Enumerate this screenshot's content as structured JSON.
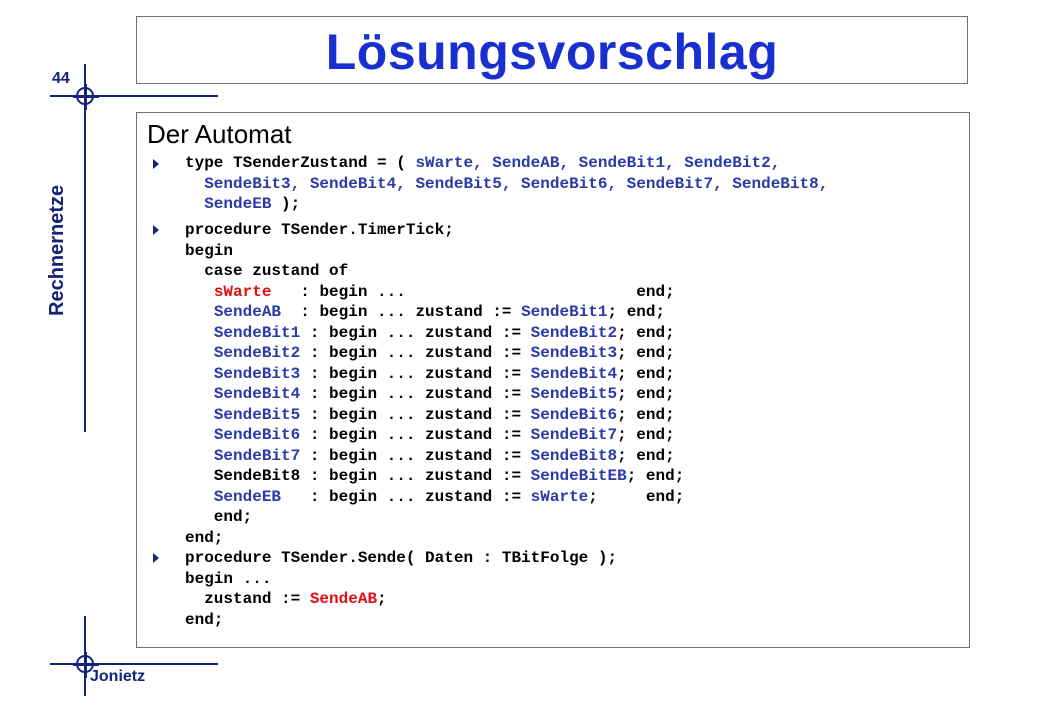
{
  "slide": {
    "title": "Lösungsvorschlag",
    "page_number": "44",
    "side_label": "Rechnernetze",
    "author": "Jonietz",
    "heading": "Der Automat"
  },
  "code": {
    "block1": [
      [
        "type TSenderZustand = ( ",
        "sWarte, SendeAB, SendeBit1, SendeBit2,"
      ],
      [
        "  ",
        "SendeBit3, SendeBit4, SendeBit5, SendeBit6, SendeBit7, SendeBit8,"
      ],
      [
        "  ",
        "SendeEB",
        " );"
      ]
    ],
    "block2": {
      "header": [
        "procedure TSender.TimerTick;",
        "begin",
        "  case zustand of"
      ],
      "rows": [
        {
          "state": "sWarte   ",
          "mid": ": begin ...                        ",
          "target": "",
          "tail": "end;"
        },
        {
          "state": "SendeAB  ",
          "mid": ": begin ... zustand := ",
          "target": "SendeBit1",
          "tail": "; end;"
        },
        {
          "state": "SendeBit1",
          "mid": " : begin ... zustand := ",
          "target": "SendeBit2",
          "tail": "; end;"
        },
        {
          "state": "SendeBit2",
          "mid": " : begin ... zustand := ",
          "target": "SendeBit3",
          "tail": "; end;"
        },
        {
          "state": "SendeBit3",
          "mid": " : begin ... zustand := ",
          "target": "SendeBit4",
          "tail": "; end;"
        },
        {
          "state": "SendeBit4",
          "mid": " : begin ... zustand := ",
          "target": "SendeBit5",
          "tail": "; end;"
        },
        {
          "state": "SendeBit5",
          "mid": " : begin ... zustand := ",
          "target": "SendeBit6",
          "tail": "; end;"
        },
        {
          "state": "SendeBit6",
          "mid": " : begin ... zustand := ",
          "target": "SendeBit7",
          "tail": "; end;"
        },
        {
          "state": "SendeBit7",
          "mid": " : begin ... zustand := ",
          "target": "SendeBit8",
          "tail": "; end;"
        },
        {
          "state": "SendeBit8",
          "mid": " : begin ... zustand := ",
          "target": "SendeBitEB",
          "tail": "; end;"
        },
        {
          "state": "SendeEB  ",
          "mid": " : begin ... zustand := ",
          "target": "sWarte",
          "tail": ";     end;"
        }
      ],
      "footer": [
        "   end;",
        "end;"
      ]
    },
    "block3": [
      "procedure TSender.Sende( Daten : TBitFolge );",
      "begin ...",
      "  zustand := ",
      "SendeAB",
      ";",
      "end;"
    ]
  }
}
